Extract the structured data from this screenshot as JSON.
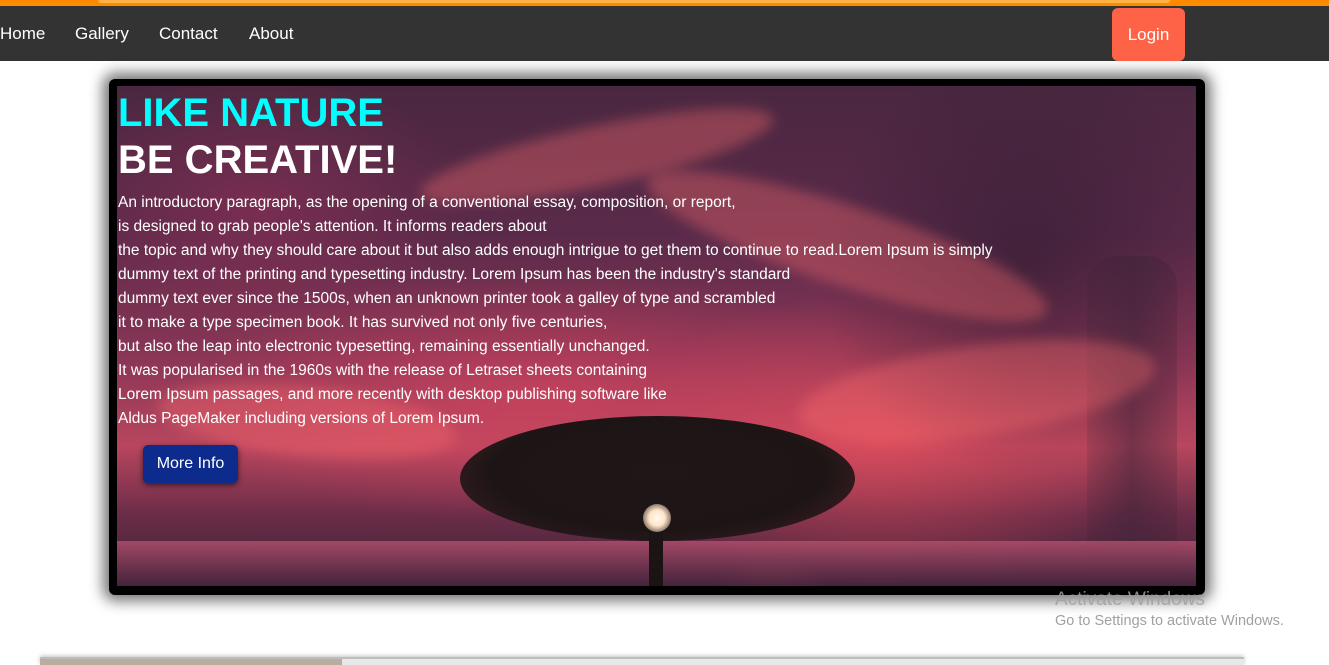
{
  "colors": {
    "accent_strip": "#ff8a00",
    "navbar_bg": "#333333",
    "login_bg": "#ff6347",
    "title_cyan": "#00ffff",
    "more_info_bg": "#0d2b8c"
  },
  "nav": {
    "links": [
      "Home",
      "Gallery",
      "Contact",
      "About"
    ],
    "login_label": "Login"
  },
  "hero": {
    "title_line_1": "LIKE NATURE",
    "title_line_2": "BE CREATIVE!",
    "intro_lines": [
      "An introductory paragraph, as the opening of a conventional essay, composition, or report,",
      "is designed to grab people's attention. It informs readers about",
      "the topic and why they should care about it but also adds enough intrigue to get them to continue to read.Lorem Ipsum is simply",
      "dummy text of the printing and typesetting industry. Lorem Ipsum has been the industry's standard",
      "dummy text ever since the 1500s, when an unknown printer took a galley of type and scrambled",
      "it to make a type specimen book. It has survived not only five centuries,",
      "but also the leap into electronic typesetting, remaining essentially unchanged.",
      "It was popularised in the 1960s with the release of Letraset sheets containing",
      "Lorem Ipsum passages, and more recently with desktop publishing software like",
      "Aldus PageMaker including versions of Lorem Ipsum."
    ],
    "button_label": "More Info",
    "background_image": "sunset-tree-landscape"
  },
  "windows_watermark": {
    "title": "Activate Windows",
    "subtitle": "Go to Settings to activate Windows."
  }
}
